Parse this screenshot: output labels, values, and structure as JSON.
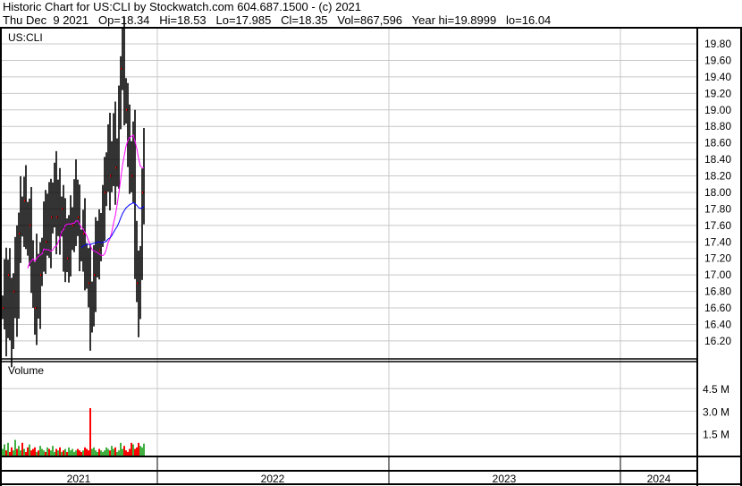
{
  "header": {
    "title": "Historic Chart for US:CLI by Stockwatch.com 604.687.1500 - (c) 2021",
    "quote": "Thu Dec  9 2021   Op=18.34   Hi=18.53   Lo=17.985   Cl=18.35   Vol=867,596   Year hi=19.8999   lo=16.04"
  },
  "colors": {
    "up": "#40b040",
    "down": "#ff0000",
    "ma_short": "#ff00ff",
    "ma_long": "#0000ff",
    "grid": "#c8c8c8"
  },
  "chart_data": {
    "type": "line",
    "symbol": "US:CLI",
    "volume_label": "Volume",
    "price_ticks": [
      "19.80",
      "19.60",
      "19.40",
      "19.20",
      "19.00",
      "18.80",
      "18.60",
      "18.40",
      "18.20",
      "18.00",
      "17.80",
      "17.60",
      "17.40",
      "17.20",
      "17.00",
      "16.80",
      "16.60",
      "16.40",
      "16.20"
    ],
    "price_range": [
      16.02,
      20.0
    ],
    "volume_ticks": [
      "4.5 M",
      "3.0 M",
      "1.5 M"
    ],
    "volume_range": [
      0,
      6.3
    ],
    "years": [
      "2021",
      "2022",
      "2023",
      "2024"
    ],
    "closes": [
      16.6,
      16.9,
      16.4,
      17.0,
      16.5,
      16.3,
      16.8,
      17.1,
      16.7,
      17.5,
      17.8,
      17.6,
      17.9,
      17.7,
      17.4,
      17.6,
      17.2,
      16.8,
      16.6,
      17.0,
      16.7,
      17.0,
      17.3,
      17.6,
      17.4,
      17.8,
      17.5,
      17.7,
      17.9,
      18.0,
      17.7,
      17.9,
      17.6,
      17.8,
      17.3,
      17.5,
      17.2,
      17.4,
      17.5,
      17.6,
      17.8,
      17.9,
      17.7,
      17.4,
      17.3,
      17.5,
      17.2,
      17.0,
      16.9,
      16.5,
      16.7,
      17.0,
      17.2,
      17.4,
      17.3,
      17.6,
      17.8,
      18.0,
      18.3,
      18.5,
      18.2,
      18.4,
      18.6,
      18.3,
      18.4,
      18.9,
      19.5,
      19.7,
      19.2,
      19.0,
      18.6,
      18.4,
      18.2,
      18.5,
      17.4,
      16.9,
      16.6,
      17.2,
      18.0,
      18.35
    ],
    "volumes_millions": [
      0.5,
      0.8,
      0.4,
      0.9,
      0.3,
      0.6,
      0.4,
      1.1,
      0.5,
      0.7,
      0.4,
      0.9,
      0.5,
      0.3,
      0.6,
      0.8,
      0.4,
      0.5,
      0.6,
      0.3,
      0.4,
      0.7,
      0.5,
      0.4,
      0.3,
      0.6,
      0.5,
      0.4,
      0.7,
      0.3,
      0.5,
      0.4,
      0.6,
      0.3,
      0.4,
      0.5,
      0.3,
      0.6,
      0.4,
      0.5,
      0.3,
      0.4,
      0.5,
      0.4,
      0.3,
      0.4,
      0.6,
      0.5,
      0.4,
      3.2,
      0.5,
      0.6,
      0.4,
      0.3,
      0.5,
      0.4,
      0.3,
      0.4,
      0.6,
      0.5,
      0.4,
      0.7,
      0.5,
      0.6,
      0.3,
      0.4,
      0.9,
      0.5,
      0.7,
      0.4,
      0.3,
      0.5,
      0.9,
      0.8,
      0.5,
      0.6,
      0.9,
      0.7,
      0.6,
      0.85
    ],
    "ma_short_period": 15,
    "ma_long_period": 45
  }
}
